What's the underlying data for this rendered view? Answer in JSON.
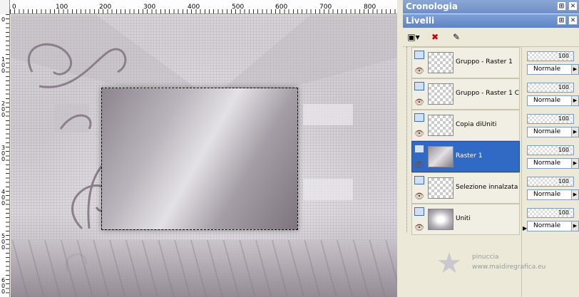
{
  "panels": {
    "history_title": "Cronologia",
    "layers_title": "Livelli",
    "title_buttons": [
      "⊞",
      "✕"
    ]
  },
  "ruler": {
    "h_labels": [
      "0",
      "100",
      "200",
      "300",
      "400",
      "500",
      "600",
      "700",
      "800"
    ],
    "v_labels": [
      "0",
      "100",
      "200",
      "300",
      "400",
      "500",
      "600"
    ]
  },
  "layers": [
    {
      "name": "Gruppo - Raster 1",
      "selected": false,
      "thumb": "checker"
    },
    {
      "name": "Gruppo - Raster 1 C",
      "selected": false,
      "thumb": "checker"
    },
    {
      "name": "Copia diUniti",
      "selected": false,
      "thumb": "checker"
    },
    {
      "name": "Raster 1",
      "selected": true,
      "thumb": "raster"
    },
    {
      "name": "Selezione innalzata",
      "selected": false,
      "thumb": "checker"
    },
    {
      "name": "Uniti",
      "selected": false,
      "thumb": "uniti"
    }
  ],
  "layer_props": [
    {
      "opacity": "100",
      "blend": "Normale"
    },
    {
      "opacity": "100",
      "blend": "Normale"
    },
    {
      "opacity": "100",
      "blend": "Normale"
    },
    {
      "opacity": "100",
      "blend": "Normale"
    },
    {
      "opacity": "100",
      "blend": "Normale"
    },
    {
      "opacity": "100",
      "blend": "Normale"
    }
  ],
  "watermark": {
    "line1": "pinuccia",
    "line2": "www.maidiregrafica.eu"
  },
  "colors": {
    "selected_row": "#316ac5",
    "title_bar": "#6e8fc4"
  }
}
